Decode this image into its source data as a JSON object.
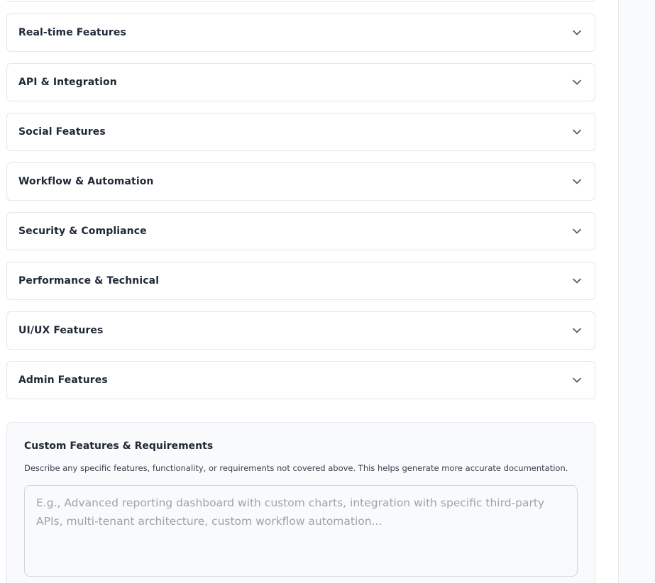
{
  "sections": [
    {
      "label": "Real-time Features",
      "icon": "chevron-down-icon"
    },
    {
      "label": "API & Integration",
      "icon": "chevron-down-icon"
    },
    {
      "label": "Social Features",
      "icon": "chevron-down-icon"
    },
    {
      "label": "Workflow & Automation",
      "icon": "chevron-down-icon"
    },
    {
      "label": "Security & Compliance",
      "icon": "chevron-down-icon"
    },
    {
      "label": "Performance & Technical",
      "icon": "chevron-down-icon"
    },
    {
      "label": "UI/UX Features",
      "icon": "chevron-down-icon"
    },
    {
      "label": "Admin Features",
      "icon": "chevron-down-icon"
    }
  ],
  "custom": {
    "title": "Custom Features & Requirements",
    "description": "Describe any specific features, functionality, or requirements not covered above. This helps generate more accurate documentation.",
    "value": "",
    "placeholder": "E.g., Advanced reporting dashboard with custom charts, integration with specific third-party APIs, multi-tenant architecture, custom workflow automation..."
  },
  "colors": {
    "border": "#e5e7eb",
    "text": "#1f2937",
    "placeholder": "#9ca3af",
    "card_bg": "#f9fafb"
  }
}
